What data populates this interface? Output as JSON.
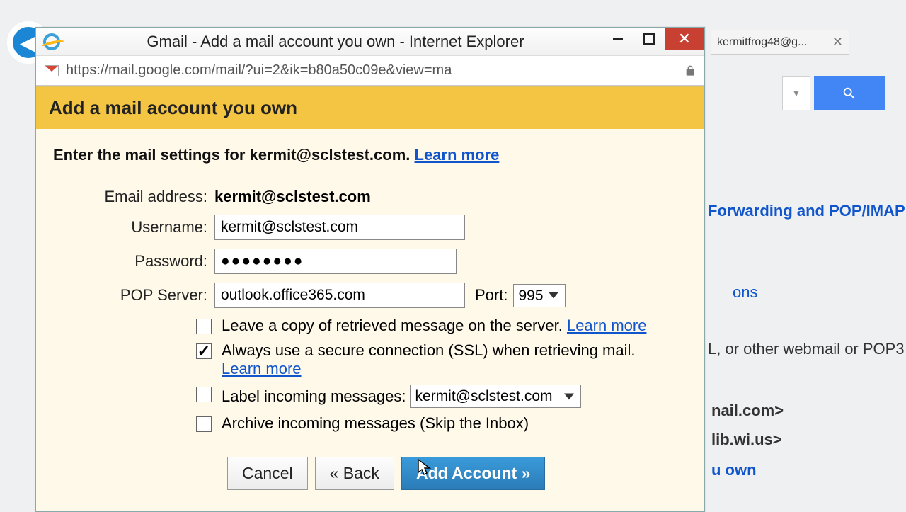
{
  "background": {
    "tab_label": "kermitfrog48@g...",
    "link_forwarding": "Forwarding and POP/IMAP",
    "link_ons": "ons",
    "text_webmail": "L, or other webmail or POP3",
    "text_mail1": "nail.com>",
    "text_mail2": "lib.wi.us>",
    "link_own": "u own"
  },
  "window": {
    "title": "Gmail - Add a mail account you own - Internet Explorer",
    "url": "https://mail.google.com/mail/?ui=2&ik=b80a50c09e&view=ma"
  },
  "dialog": {
    "header": "Add a mail account you own",
    "prompt_prefix": "Enter the mail settings for ",
    "prompt_email": "kermit@sclstest.com",
    "prompt_suffix": ". ",
    "learn_more": "Learn more",
    "labels": {
      "email": "Email address:",
      "username": "Username:",
      "password": "Password:",
      "pop": "POP Server:",
      "port": "Port:"
    },
    "values": {
      "email": "kermit@sclstest.com",
      "username": "kermit@sclstest.com",
      "password": "●●●●●●●●",
      "pop": "outlook.office365.com",
      "port": "995",
      "label_select": "kermit@sclstest.com"
    },
    "options": {
      "leave_copy": "Leave a copy of retrieved message on the server. ",
      "ssl": "Always use a secure connection (SSL) when retrieving mail.",
      "label_incoming": "Label incoming messages: ",
      "archive": "Archive incoming messages (Skip the Inbox)"
    },
    "buttons": {
      "cancel": "Cancel",
      "back": "« Back",
      "add": "Add Account »"
    }
  }
}
